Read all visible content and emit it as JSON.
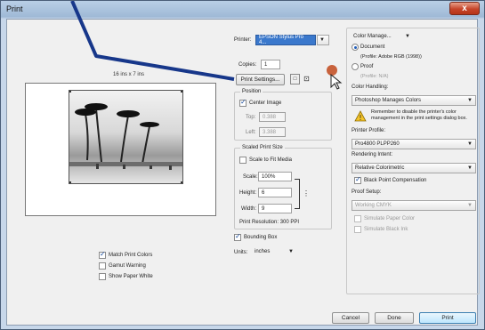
{
  "window": {
    "title": "Print",
    "close_label": "x"
  },
  "printer": {
    "label": "Printer:",
    "value": "EPSON Stylus Pro 4..."
  },
  "copies": {
    "label": "Copies:",
    "value": "1"
  },
  "print_settings_label": "Print Settings...",
  "preview": {
    "paper_size": "16 ins x 7 ins"
  },
  "position": {
    "title": "Position",
    "center_image": "Center Image",
    "top_label": "Top:",
    "top_value": "0.388",
    "left_label": "Left:",
    "left_value": "3.388"
  },
  "scaled": {
    "title": "Scaled Print Size",
    "scale_to_fit": "Scale to Fit Media",
    "scale_label": "Scale:",
    "scale_value": "100%",
    "height_label": "Height:",
    "height_value": "6",
    "width_label": "Width:",
    "width_value": "9",
    "resolution": "Print Resolution: 300 PPI"
  },
  "bounding_box": "Bounding Box",
  "units": {
    "label": "Units:",
    "value": "inches"
  },
  "left_options": {
    "match_print_colors": "Match Print Colors",
    "gamut_warning": "Gamut Warning",
    "show_paper_white": "Show Paper White"
  },
  "color": {
    "manage_label": "Color Manage...",
    "document": "Document",
    "document_profile": "(Profile: Adobe RGB (1998))",
    "proof": "Proof",
    "proof_profile": "(Profile: N/A)",
    "handling_label": "Color Handling:",
    "handling_value": "Photoshop Manages Colors",
    "warning_text": "Remember to disable the printer's color management in the print settings dialog box.",
    "profile_label": "Printer Profile:",
    "profile_value": "Pro4800 PLPP260",
    "intent_label": "Rendering Intent:",
    "intent_value": "Relative Colorimetric",
    "bpc": "Black Point Compensation",
    "proof_setup_label": "Proof Setup:",
    "proof_setup_value": "Working CMYK",
    "sim_paper": "Simulate Paper Color",
    "sim_ink": "Simulate Black Ink"
  },
  "buttons": {
    "cancel": "Cancel",
    "done": "Done",
    "print": "Print"
  },
  "colors": {
    "accent": "#3874c8",
    "annotation_arrow": "#17378a",
    "cursor_dot": "#c8623c"
  }
}
